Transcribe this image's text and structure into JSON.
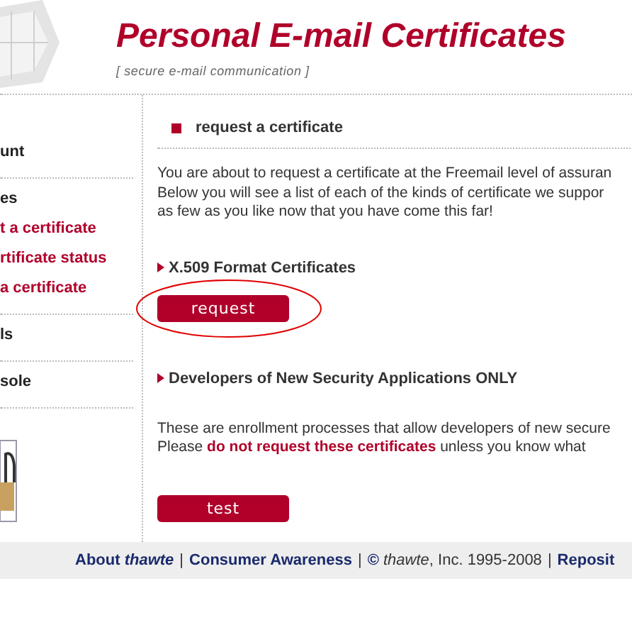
{
  "header": {
    "title": "Personal E-mail Certificates",
    "subtitle": "[ secure e-mail communication ]"
  },
  "sidebar": {
    "groups": [
      {
        "items": [
          {
            "kind": "heading",
            "text": "unt"
          }
        ]
      },
      {
        "items": [
          {
            "kind": "heading",
            "text": "es"
          },
          {
            "kind": "link",
            "text": "t a certificate"
          },
          {
            "kind": "link",
            "text": "rtificate status"
          },
          {
            "kind": "link",
            "text": "a certificate"
          }
        ]
      },
      {
        "items": [
          {
            "kind": "heading",
            "text": "ls"
          }
        ]
      },
      {
        "items": [
          {
            "kind": "heading",
            "text": "sole"
          }
        ]
      }
    ]
  },
  "main": {
    "heading": "request a certificate",
    "intro": [
      "You are about to request a certificate at the Freemail level of assuran",
      "Below you will see a list of each of the kinds of certificate we suppor",
      "as few as you like now that you have come this far!"
    ],
    "sections": [
      {
        "title": "X.509 Format Certificates",
        "button": "request",
        "circled": true
      },
      {
        "title": "Developers of New Security Applications ONLY",
        "lines": [
          "These are enrollment processes that allow developers of new secure",
          "Please **do not request these certificates** unless you know what"
        ],
        "button": "test",
        "circled": false
      }
    ]
  },
  "footer": [
    {
      "kind": "link",
      "text": "About *thawte*"
    },
    {
      "kind": "sep",
      "text": "|"
    },
    {
      "kind": "link",
      "text": "Consumer Awareness"
    },
    {
      "kind": "sep",
      "text": "|"
    },
    {
      "kind": "text",
      "text": "**©** *thawte*, Inc. 1995-2008"
    },
    {
      "kind": "sep",
      "text": "|"
    },
    {
      "kind": "link",
      "text": "Reposit"
    }
  ]
}
